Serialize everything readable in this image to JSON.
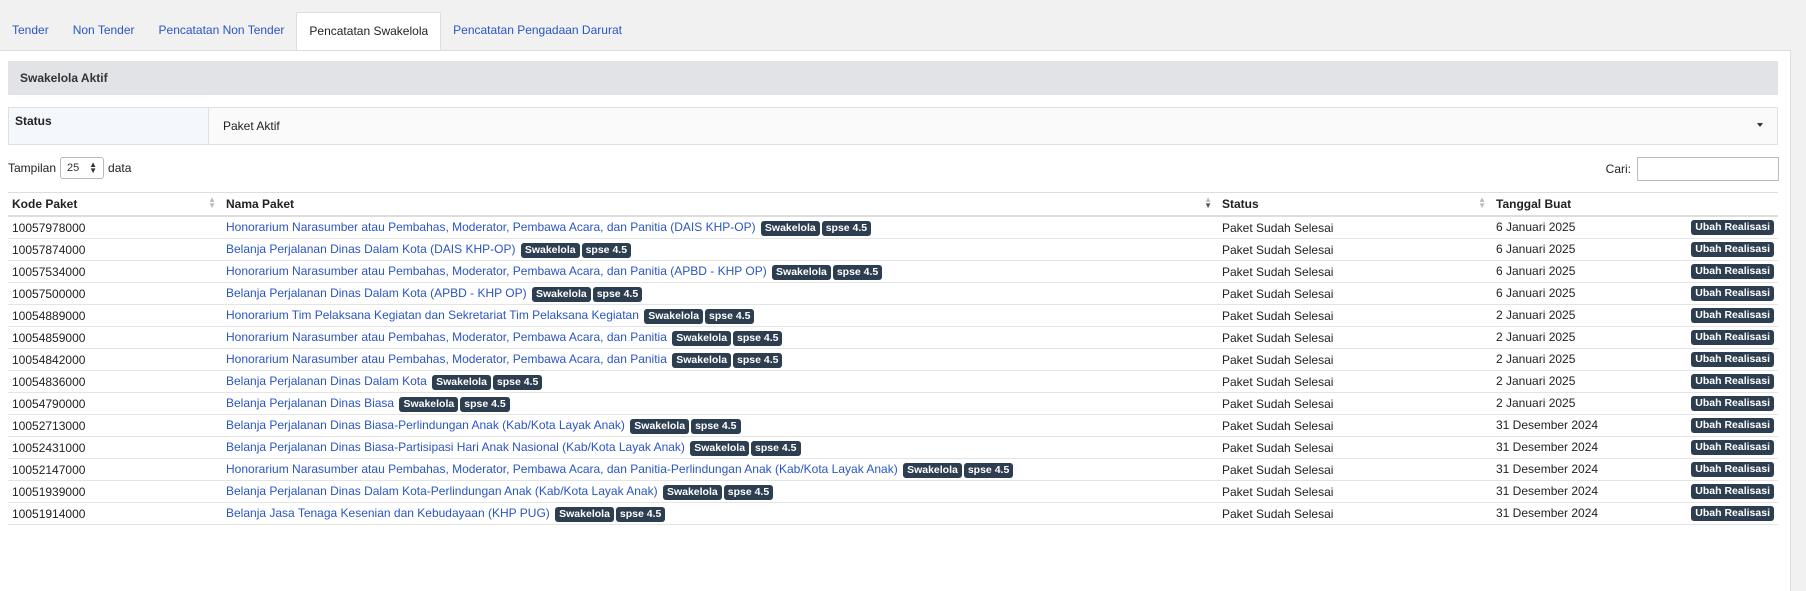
{
  "tabs": [
    {
      "label": "Tender",
      "active": false
    },
    {
      "label": "Non Tender",
      "active": false
    },
    {
      "label": "Pencatatan Non Tender",
      "active": false
    },
    {
      "label": "Pencatatan Swakelola",
      "active": true
    },
    {
      "label": "Pencatatan Pengadaan Darurat",
      "active": false
    }
  ],
  "section_title": "Swakelola Aktif",
  "filter": {
    "label": "Status",
    "value": "Paket Aktif"
  },
  "length": {
    "prefix": "Tampilan",
    "value": "25",
    "suffix": "data"
  },
  "search": {
    "label": "Cari:",
    "value": ""
  },
  "table": {
    "headers": [
      "Kode Paket",
      "Nama Paket",
      "Status",
      "Tanggal Buat"
    ],
    "badge1": "Swakelola",
    "badge2": "spse 4.5",
    "action_label": "Ubah Realisasi",
    "rows": [
      {
        "kode": "10057978000",
        "nama": "Honorarium Narasumber atau Pembahas, Moderator, Pembawa Acara, dan Panitia (DAIS KHP-OP)",
        "status": "Paket Sudah Selesai",
        "tanggal": "6 Januari 2025"
      },
      {
        "kode": "10057874000",
        "nama": "Belanja Perjalanan Dinas Dalam Kota (DAIS KHP-OP)",
        "status": "Paket Sudah Selesai",
        "tanggal": "6 Januari 2025"
      },
      {
        "kode": "10057534000",
        "nama": "Honorarium Narasumber atau Pembahas, Moderator, Pembawa Acara, dan Panitia (APBD - KHP OP)",
        "status": "Paket Sudah Selesai",
        "tanggal": "6 Januari 2025"
      },
      {
        "kode": "10057500000",
        "nama": "Belanja Perjalanan Dinas Dalam Kota (APBD - KHP OP)",
        "status": "Paket Sudah Selesai",
        "tanggal": "6 Januari 2025"
      },
      {
        "kode": "10054889000",
        "nama": "Honorarium Tim Pelaksana Kegiatan dan Sekretariat Tim Pelaksana Kegiatan",
        "status": "Paket Sudah Selesai",
        "tanggal": "2 Januari 2025"
      },
      {
        "kode": "10054859000",
        "nama": "Honorarium Narasumber atau Pembahas, Moderator, Pembawa Acara, dan Panitia",
        "status": "Paket Sudah Selesai",
        "tanggal": "2 Januari 2025"
      },
      {
        "kode": "10054842000",
        "nama": "Honorarium Narasumber atau Pembahas, Moderator, Pembawa Acara, dan Panitia",
        "status": "Paket Sudah Selesai",
        "tanggal": "2 Januari 2025"
      },
      {
        "kode": "10054836000",
        "nama": "Belanja Perjalanan Dinas Dalam Kota",
        "status": "Paket Sudah Selesai",
        "tanggal": "2 Januari 2025"
      },
      {
        "kode": "10054790000",
        "nama": "Belanja Perjalanan Dinas Biasa",
        "status": "Paket Sudah Selesai",
        "tanggal": "2 Januari 2025"
      },
      {
        "kode": "10052713000",
        "nama": "Belanja Perjalanan Dinas Biasa-Perlindungan Anak (Kab/Kota Layak Anak)",
        "status": "Paket Sudah Selesai",
        "tanggal": "31 Desember 2024"
      },
      {
        "kode": "10052431000",
        "nama": "Belanja Perjalanan Dinas Biasa-Partisipasi Hari Anak Nasional (Kab/Kota Layak Anak)",
        "status": "Paket Sudah Selesai",
        "tanggal": "31 Desember 2024"
      },
      {
        "kode": "10052147000",
        "nama": "Honorarium Narasumber atau Pembahas, Moderator, Pembawa Acara, dan Panitia-Perlindungan Anak (Kab/Kota Layak Anak)",
        "status": "Paket Sudah Selesai",
        "tanggal": "31 Desember 2024"
      },
      {
        "kode": "10051939000",
        "nama": "Belanja Perjalanan Dinas Dalam Kota-Perlindungan Anak (Kab/Kota Layak Anak)",
        "status": "Paket Sudah Selesai",
        "tanggal": "31 Desember 2024"
      },
      {
        "kode": "10051914000",
        "nama": "Belanja Jasa Tenaga Kesenian dan Kebudayaan (KHP PUG)",
        "status": "Paket Sudah Selesai",
        "tanggal": "31 Desember 2024"
      }
    ]
  }
}
